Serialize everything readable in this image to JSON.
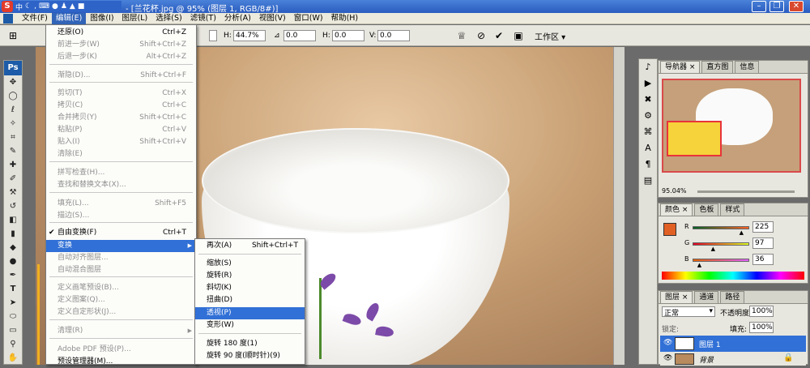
{
  "window": {
    "title": "- [兰花杯.jpg @ 95% (图层 1, RGB/8#)]",
    "ime_label": "中",
    "min": "–",
    "max": "❐",
    "close": "✕"
  },
  "menubar": {
    "items": [
      "文件(F)",
      "编辑(E)",
      "图像(I)",
      "图层(L)",
      "选择(S)",
      "滤镜(T)",
      "分析(A)",
      "视图(V)",
      "窗口(W)",
      "帮助(H)"
    ]
  },
  "options": {
    "h_label": "H:",
    "h_value": "44.7%",
    "angle_value": "0.0",
    "hskew_label": "H:",
    "hskew_value": "0.0",
    "vskew_label": "V:",
    "vskew_value": "0.0",
    "workspace": "工作区 ▾"
  },
  "edit_menu": {
    "items": [
      {
        "label": "还原(O)",
        "shortcut": "Ctrl+Z",
        "disabled": false
      },
      {
        "label": "前进一步(W)",
        "shortcut": "Shift+Ctrl+Z",
        "disabled": true
      },
      {
        "label": "后退一步(K)",
        "shortcut": "Alt+Ctrl+Z",
        "disabled": true
      },
      {
        "label": "渐隐(D)...",
        "shortcut": "Shift+Ctrl+F",
        "disabled": true
      },
      {
        "label": "剪切(T)",
        "shortcut": "Ctrl+X",
        "disabled": true
      },
      {
        "label": "拷贝(C)",
        "shortcut": "Ctrl+C",
        "disabled": true
      },
      {
        "label": "合并拷贝(Y)",
        "shortcut": "Shift+Ctrl+C",
        "disabled": true
      },
      {
        "label": "粘贴(P)",
        "shortcut": "Ctrl+V",
        "disabled": true
      },
      {
        "label": "贴入(I)",
        "shortcut": "Shift+Ctrl+V",
        "disabled": true
      },
      {
        "label": "清除(E)",
        "shortcut": "",
        "disabled": true
      },
      {
        "label": "拼写检查(H)...",
        "shortcut": "",
        "disabled": true
      },
      {
        "label": "查找和替换文本(X)...",
        "shortcut": "",
        "disabled": true
      },
      {
        "label": "填充(L)...",
        "shortcut": "Shift+F5",
        "disabled": true
      },
      {
        "label": "描边(S)...",
        "shortcut": "",
        "disabled": true
      },
      {
        "label": "自由变换(F)",
        "shortcut": "Ctrl+T",
        "disabled": false,
        "checked": true
      },
      {
        "label": "变换",
        "shortcut": "",
        "disabled": false,
        "highlighted": true,
        "submenu": true
      },
      {
        "label": "自动对齐图层...",
        "shortcut": "",
        "disabled": true
      },
      {
        "label": "自动混合图层",
        "shortcut": "",
        "disabled": true
      },
      {
        "label": "定义画笔预设(B)...",
        "shortcut": "",
        "disabled": true
      },
      {
        "label": "定义图案(Q)...",
        "shortcut": "",
        "disabled": true
      },
      {
        "label": "定义自定形状(J)...",
        "shortcut": "",
        "disabled": true
      },
      {
        "label": "清理(R)",
        "shortcut": "",
        "disabled": true,
        "submenu": true
      },
      {
        "label": "Adobe PDF 预设(P)...",
        "shortcut": "",
        "disabled": true
      },
      {
        "label": "预设管理器(M)...",
        "shortcut": "",
        "disabled": false
      }
    ]
  },
  "transform_submenu": {
    "items": [
      {
        "label": "再次(A)",
        "shortcut": "Shift+Ctrl+T"
      },
      {
        "label": "缩放(S)",
        "shortcut": ""
      },
      {
        "label": "旋转(R)",
        "shortcut": ""
      },
      {
        "label": "斜切(K)",
        "shortcut": ""
      },
      {
        "label": "扭曲(D)",
        "shortcut": ""
      },
      {
        "label": "透视(P)",
        "shortcut": "",
        "highlighted": true
      },
      {
        "label": "变形(W)",
        "shortcut": ""
      },
      {
        "label": "旋转 180 度(1)",
        "shortcut": ""
      },
      {
        "label": "旋转 90 度(顺时针)(9)",
        "shortcut": ""
      }
    ]
  },
  "navigator": {
    "tabs": [
      "导航器 ×",
      "直方图",
      "信息"
    ],
    "zoom": "95.04%"
  },
  "color_panel": {
    "tabs": [
      "颜色 ×",
      "色板",
      "样式"
    ],
    "r_label": "R",
    "g_label": "G",
    "b_label": "B",
    "r": "225",
    "g": "97",
    "b": "36",
    "r_level": 0.88,
    "g_level": 0.38,
    "b_level": 0.14,
    "swatch": "#e16124"
  },
  "layers_panel": {
    "tabs": [
      "图层 ×",
      "通道",
      "路径"
    ],
    "blend_mode": "正常",
    "opacity_label": "不透明度:",
    "opacity": "100%",
    "lock_label": "锁定:",
    "fill_label": "填充:",
    "fill": "100%",
    "layers": [
      {
        "name": "图层 1",
        "selected": true
      },
      {
        "name": "背景",
        "selected": false
      }
    ]
  },
  "toolbox": {
    "logo": "Ps"
  },
  "colors": {
    "accent": "#3170d6",
    "title_blue": "#2a5cbf"
  }
}
